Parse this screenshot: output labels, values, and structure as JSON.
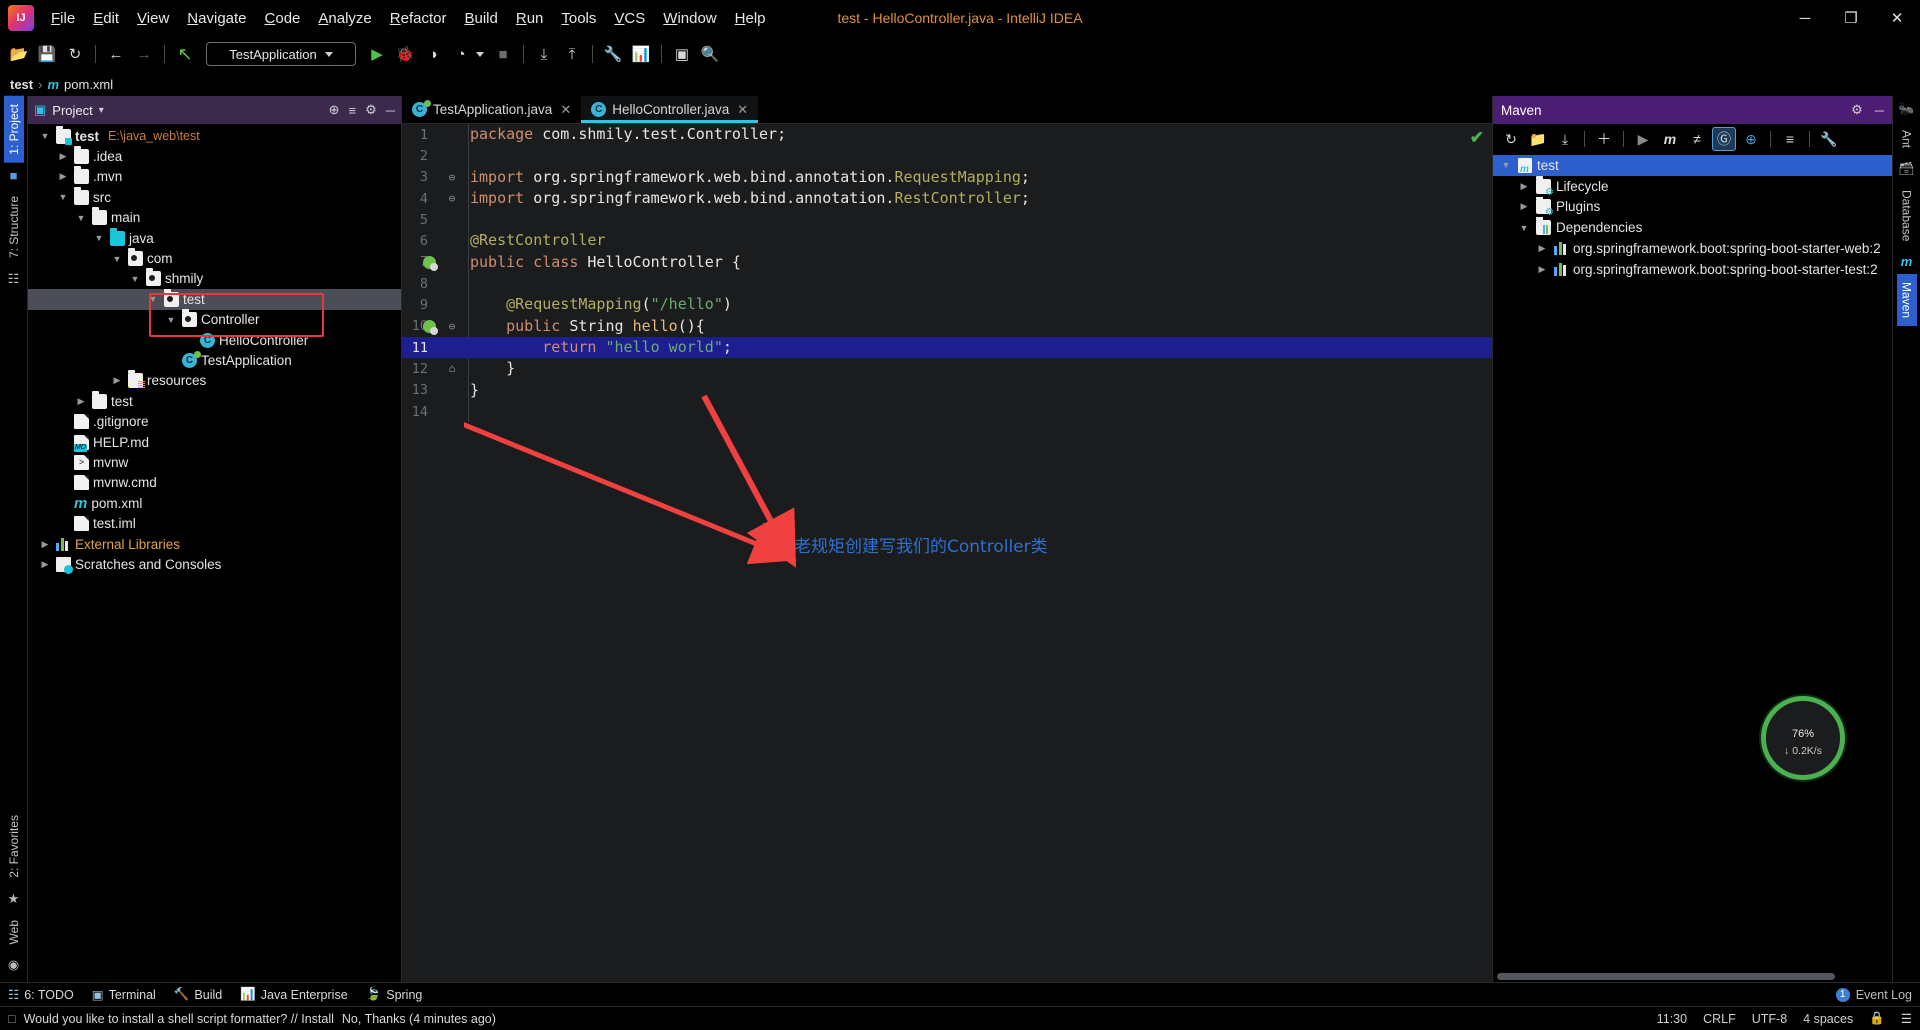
{
  "window": {
    "title": "test - HelloController.java - IntelliJ IDEA",
    "minimize": "─",
    "maximize": "❐",
    "close": "✕"
  },
  "menu": {
    "items": [
      "File",
      "Edit",
      "View",
      "Navigate",
      "Code",
      "Analyze",
      "Refactor",
      "Build",
      "Run",
      "Tools",
      "VCS",
      "Window",
      "Help"
    ]
  },
  "toolbar": {
    "open_icon": "📂",
    "save_icon": "💾",
    "sync_icon": "↻",
    "back_icon": "←",
    "forward_icon": "→",
    "build_icon": "↖",
    "run_config": "TestApplication",
    "run_icon": "▶",
    "debug_icon": "🐞",
    "run_coverage_icon": "◑",
    "profile_icon": "◔",
    "stop_icon": "■",
    "update_icon": "⤓",
    "commit_icon": "⤒",
    "settings_icon": "🔧",
    "structure_icon": "📊",
    "layout_icon": "▣",
    "search_icon": "🔍"
  },
  "breadcrumb": {
    "project": "test",
    "separator": "›",
    "maven_icon": "m",
    "file": "pom.xml"
  },
  "left_rail": {
    "project_tab": "1: Project",
    "structure_tab": "7: Structure",
    "favorites_tab": "2: Favorites",
    "web_tab": "Web",
    "folder_icon": "■",
    "structure_icon": "☷",
    "star_icon": "★",
    "web_icon": "◉"
  },
  "project_panel": {
    "title": "Project",
    "dropdown_icon": "▾",
    "panel_icon": "▣",
    "locate_icon": "⊕",
    "collapse_icon": "≡",
    "gear_icon": "⚙",
    "hide_icon": "─",
    "tree": [
      {
        "label": "test",
        "path": "E:\\java_web\\test",
        "depth": 0,
        "twisty": "▼",
        "icon": "module",
        "bold": true
      },
      {
        "label": ".idea",
        "depth": 1,
        "twisty": "▶",
        "icon": "folder"
      },
      {
        "label": ".mvn",
        "depth": 1,
        "twisty": "▶",
        "icon": "folder"
      },
      {
        "label": "src",
        "depth": 1,
        "twisty": "▼",
        "icon": "folder"
      },
      {
        "label": "main",
        "depth": 2,
        "twisty": "▼",
        "icon": "folder"
      },
      {
        "label": "java",
        "depth": 3,
        "twisty": "▼",
        "icon": "source-folder"
      },
      {
        "label": "com",
        "depth": 4,
        "twisty": "▼",
        "icon": "package"
      },
      {
        "label": "shmily",
        "depth": 5,
        "twisty": "▼",
        "icon": "package"
      },
      {
        "label": "test",
        "depth": 6,
        "twisty": "▼",
        "icon": "package",
        "selected": true
      },
      {
        "label": "Controller",
        "depth": 7,
        "twisty": "▼",
        "icon": "package"
      },
      {
        "label": "HelloController",
        "depth": 8,
        "twisty": "",
        "icon": "class"
      },
      {
        "label": "TestApplication",
        "depth": 7,
        "twisty": "",
        "icon": "spring-class"
      },
      {
        "label": "resources",
        "depth": 4,
        "twisty": "▶",
        "icon": "resource-folder"
      },
      {
        "label": "test",
        "depth": 2,
        "twisty": "▶",
        "icon": "folder"
      },
      {
        "label": ".gitignore",
        "depth": 1,
        "twisty": "",
        "icon": "gitignore-file"
      },
      {
        "label": "HELP.md",
        "depth": 1,
        "twisty": "",
        "icon": "md-file"
      },
      {
        "label": "mvnw",
        "depth": 1,
        "twisty": "",
        "icon": "script-file"
      },
      {
        "label": "mvnw.cmd",
        "depth": 1,
        "twisty": "",
        "icon": "cmd-file"
      },
      {
        "label": "pom.xml",
        "depth": 1,
        "twisty": "",
        "icon": "maven-file"
      },
      {
        "label": "test.iml",
        "depth": 1,
        "twisty": "",
        "icon": "iml-file"
      },
      {
        "label": "External Libraries",
        "depth": 0,
        "twisty": "▶",
        "icon": "libraries",
        "ext": true
      },
      {
        "label": "Scratches and Consoles",
        "depth": 0,
        "twisty": "▶",
        "icon": "scratches"
      }
    ]
  },
  "editor": {
    "tabs": [
      {
        "label": "TestApplication.java",
        "icon": "spring-class",
        "active": false,
        "close": "✕"
      },
      {
        "label": "HelloController.java",
        "icon": "class",
        "active": true,
        "close": "✕"
      }
    ],
    "inspection_ok_icon": "✔",
    "code_lines": [
      {
        "n": 1,
        "tokens": [
          {
            "t": "package ",
            "c": "kw"
          },
          {
            "t": "com.shmily.test.Controller",
            "c": "pln"
          },
          {
            "t": ";",
            "c": "semi"
          }
        ]
      },
      {
        "n": 2,
        "tokens": []
      },
      {
        "n": 3,
        "fold": "⊖",
        "tokens": [
          {
            "t": "import ",
            "c": "kw"
          },
          {
            "t": "org.springframework.web.bind.annotation.",
            "c": "pln"
          },
          {
            "t": "RequestMapping",
            "c": "ann"
          },
          {
            "t": ";",
            "c": "semi"
          }
        ]
      },
      {
        "n": 4,
        "fold": "⊖",
        "tokens": [
          {
            "t": "import ",
            "c": "kw"
          },
          {
            "t": "org.springframework.web.bind.annotation.",
            "c": "pln"
          },
          {
            "t": "RestController",
            "c": "ann"
          },
          {
            "t": ";",
            "c": "semi"
          }
        ]
      },
      {
        "n": 5,
        "tokens": []
      },
      {
        "n": 6,
        "tokens": [
          {
            "t": "@RestController",
            "c": "ann"
          }
        ]
      },
      {
        "n": 7,
        "run": true,
        "tokens": [
          {
            "t": "public class ",
            "c": "kw"
          },
          {
            "t": "HelloController ",
            "c": "typ"
          },
          {
            "t": "{",
            "c": "pln"
          }
        ]
      },
      {
        "n": 8,
        "tokens": []
      },
      {
        "n": 9,
        "tokens": [
          {
            "t": "    ",
            "c": "pln"
          },
          {
            "t": "@RequestMapping",
            "c": "ann"
          },
          {
            "t": "(",
            "c": "pln"
          },
          {
            "t": "\"/hello\"",
            "c": "str"
          },
          {
            "t": ")",
            "c": "pln"
          }
        ]
      },
      {
        "n": 10,
        "run": true,
        "fold": "⊖",
        "tokens": [
          {
            "t": "    ",
            "c": "pln"
          },
          {
            "t": "public ",
            "c": "kw"
          },
          {
            "t": "String ",
            "c": "typ"
          },
          {
            "t": "hello",
            "c": "meth"
          },
          {
            "t": "(){",
            "c": "pln"
          }
        ]
      },
      {
        "n": 11,
        "highlight": true,
        "tokens": [
          {
            "t": "        ",
            "c": "pln"
          },
          {
            "t": "return ",
            "c": "kw"
          },
          {
            "t": "\"hello world\"",
            "c": "str"
          },
          {
            "t": ";",
            "c": "semi"
          }
        ]
      },
      {
        "n": 12,
        "fold": "⌂",
        "tokens": [
          {
            "t": "    }",
            "c": "pln"
          }
        ]
      },
      {
        "n": 13,
        "tokens": [
          {
            "t": "}",
            "c": "pln"
          }
        ]
      },
      {
        "n": 14,
        "tokens": []
      }
    ]
  },
  "annotation": {
    "text": "老规矩创建写我们的Controller类",
    "color": "#2f6fd0",
    "arrow_color": "#f04040"
  },
  "maven_panel": {
    "title": "Maven",
    "gear_icon": "⚙",
    "hide_icon": "─",
    "reimport_icon": "↻",
    "generate_sources_icon": "📁",
    "download_sources_icon": "⤓",
    "add_icon": "＋",
    "run_icon": "▶",
    "maven_m_icon": "m",
    "skip_tests_icon": "≠",
    "execute_goal_icon": "Ⓖ",
    "toggle_offline_icon": "⊕",
    "collapse_icon": "≡",
    "settings_icon": "🔧",
    "tree": [
      {
        "label": "test",
        "depth": 0,
        "twisty": "▼",
        "icon": "maven-project",
        "selected": true
      },
      {
        "label": "Lifecycle",
        "depth": 1,
        "twisty": "▶",
        "icon": "lifecycle-folder"
      },
      {
        "label": "Plugins",
        "depth": 1,
        "twisty": "▶",
        "icon": "plugins-folder"
      },
      {
        "label": "Dependencies",
        "depth": 1,
        "twisty": "▼",
        "icon": "dependencies-folder"
      },
      {
        "label": "org.springframework.boot:spring-boot-starter-web:2",
        "depth": 2,
        "twisty": "▶",
        "icon": "jar"
      },
      {
        "label": "org.springframework.boot:spring-boot-starter-test:2",
        "depth": 2,
        "twisty": "▶",
        "icon": "jar"
      }
    ]
  },
  "right_rail": {
    "ant_tab": "Ant",
    "database_tab": "Database",
    "maven_tab": "Maven",
    "ant_icon": "🐜",
    "database_icon": "🗃",
    "maven_icon": "m"
  },
  "network_widget": {
    "percent": "76",
    "percent_symbol": "%",
    "rate": "↓ 0.2K/s"
  },
  "toolwindow_bar": {
    "items": [
      {
        "label": "6: TODO",
        "icon": "☷"
      },
      {
        "label": "Terminal",
        "icon": "▣"
      },
      {
        "label": "Build",
        "icon": "🔨"
      },
      {
        "label": "Java Enterprise",
        "icon": "📊"
      },
      {
        "label": "Spring",
        "icon": "🍃"
      }
    ],
    "event_log": "Event Log",
    "event_count": "1"
  },
  "status_bar": {
    "message": "Would you like to install a shell script formatter? // Install",
    "dismiss": "No, Thanks (4 minutes ago)",
    "notification_icon": "□",
    "time": "11:30",
    "line_sep": "CRLF",
    "encoding": "UTF-8",
    "indent": "4 spaces",
    "lock_icon": "🔒",
    "inspect_icon": "☰"
  }
}
